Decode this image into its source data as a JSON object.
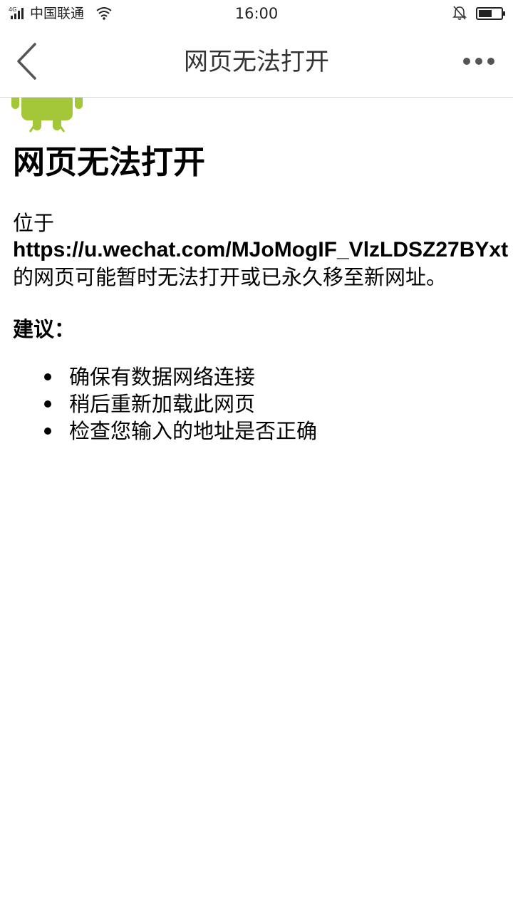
{
  "status_bar": {
    "network": "4G",
    "carrier": "中国联通",
    "time": "16:00"
  },
  "nav": {
    "title": "网页无法打开",
    "back_icon": "chevron-left-icon",
    "more_icon": "more-dots-icon"
  },
  "error_page": {
    "icon": "android-robot-icon",
    "heading": "网页无法打开",
    "message_prefix": "位于",
    "url": "https://u.wechat.com/MJoMogIF_VlzLDSZ27BYxt",
    "message_suffix": "的网页可能暂时无法打开或已永久移至新网址。",
    "suggestions_title": "建议：",
    "suggestions": [
      "确保有数据网络连接",
      "稍后重新加载此网页",
      "检查您输入的地址是否正确"
    ]
  },
  "colors": {
    "android_green": "#a4c639",
    "divider": "#d9d9d9",
    "nav_title": "#333333"
  }
}
